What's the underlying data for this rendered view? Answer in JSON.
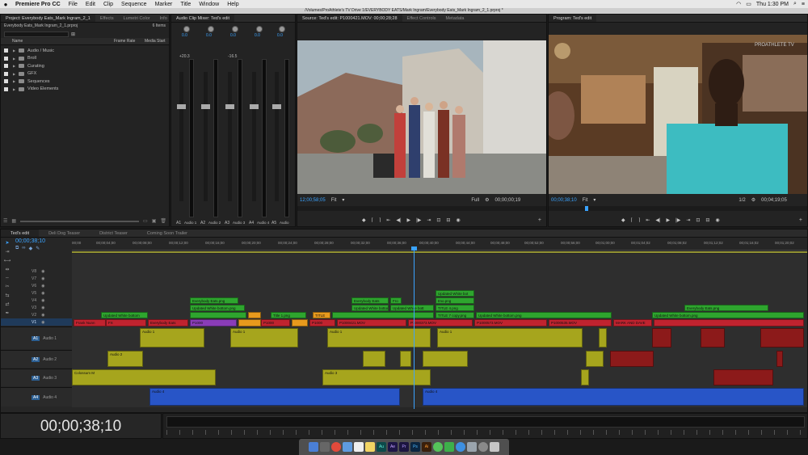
{
  "menubar": {
    "app": "Premiere Pro CC",
    "items": [
      "File",
      "Edit",
      "Clip",
      "Sequence",
      "Marker",
      "Title",
      "Window",
      "Help"
    ],
    "clock": "Thu 1:30 PM"
  },
  "window_title": "/Volumes/ProAthlete's TV Drive 1/EVERYBODY EATS/Mark Ingram/Everybody Eats_Mark Ingram_2_1.prproj *",
  "project": {
    "tabs": [
      "Project: Everybody Eats_Mark Ingram_2_1",
      "Effects",
      "Lumetri Color",
      "Info"
    ],
    "file": "Everybody Eats_Mark Ingram_2_1.prproj",
    "count": "6 Items",
    "search_hint": "",
    "columns": [
      "Name",
      "Frame Rate",
      "Media Start"
    ],
    "items": [
      "Audio / Music",
      "Broll",
      "Curating",
      "GFX",
      "Sequences",
      "Video Elements"
    ]
  },
  "mixer": {
    "tab": "Audio Clip Mixer: Ted's edit",
    "channels": [
      {
        "label": "A1",
        "name": "Audio 1",
        "val": "0.0",
        "db": "+20.3"
      },
      {
        "label": "A2",
        "name": "Audio 2",
        "val": "0.0",
        "db": ""
      },
      {
        "label": "A3",
        "name": "Audio 3",
        "val": "0.0",
        "db": "-16.5"
      },
      {
        "label": "A4",
        "name": "Audio 4",
        "val": "0.0",
        "db": ""
      },
      {
        "label": "A5",
        "name": "Audio",
        "val": "0.0",
        "db": ""
      }
    ]
  },
  "source": {
    "tabs": [
      "Source: Ted's edit: P1000421.MOV: 00;00;28;28",
      "Effect Controls",
      "Metadata"
    ],
    "timecode": "12;00;58;05",
    "fit": "Fit",
    "quality": "Full",
    "duration": "00;00;00;19"
  },
  "program": {
    "tabs": [
      "Program: Ted's edit"
    ],
    "watermark": "PROATHLETE TV",
    "timecode": "00;00;38;10",
    "fit": "Fit",
    "quality": "1/2",
    "duration": "00;04;19;05"
  },
  "timeline": {
    "tabs": [
      "Ted's edit",
      "Deli Dog Teaser",
      "District Teaser",
      "Coming Soon Trailer"
    ],
    "timecode": "00;00;38;10",
    "big_timecode": "00;00;38;10",
    "ruler": [
      "00;00",
      "00;00;04;00",
      "00;00;08;00",
      "00;00;12;00",
      "00;00;16;00",
      "00;00;20;00",
      "00;00;24;00",
      "00;00;28;00",
      "00;00;32;00",
      "00;00;36;00",
      "00;00;40;00",
      "00;00;44;00",
      "00;00;48;00",
      "00;00;52;00",
      "00;00;56;00",
      "00;01;00;00",
      "00;01;04;02",
      "00;01;08;02",
      "00;01;12;02",
      "00;01;16;02",
      "00;01;20;02"
    ],
    "tracks": {
      "video": [
        "V8",
        "V7",
        "V6",
        "V5",
        "V4",
        "V3",
        "V2",
        "V1"
      ],
      "audio": [
        {
          "id": "A1",
          "name": "Audio 1"
        },
        {
          "id": "A2",
          "name": "Audio 2"
        },
        {
          "id": "A3",
          "name": "Audio 3"
        },
        {
          "id": "A4",
          "name": "Audio 4"
        }
      ]
    },
    "clip_labels": {
      "everybody_eats_png": "Everybody Eats.png",
      "updated_white_bottom_png": "Updated White bottom.png",
      "updated_white_bottom_trunc": "Updated White bottom",
      "updated_white_bot": "Updated White bot",
      "updated_white_bottom_pn": "Updated White bottom pn",
      "everybody_eats_pn": "Everybody Eats.pn",
      "fro": "Fro",
      "title_1_png": "Title 1.png",
      "title": "TITLE",
      "title_4_png": "TITLE 4.png",
      "title_7_copy_png": "TITLE 7 copy.png",
      "tmo_png": "tmo.png",
      "updated_white_bott": "Updated White bott",
      "frank_nunn": "Frank Nunn",
      "everybody_eats": "Everybody Eats",
      "p1000": "P1000",
      "p1000421": "P1000421.MOV",
      "p1000373": "P1000373.MOV",
      "p1000573": "P1000573.MOV",
      "p1000535": "P1000535.MOV",
      "fx": "FX",
      "mark_and_dave": "MARK AND DAVE",
      "audio_1": "Audio 1",
      "audio_2": "Audio 2",
      "audio_3": "Audio 3",
      "audio_4": "Audio 4",
      "colossum": "Colossum M"
    }
  },
  "dock_apps": [
    "Finder",
    "Launchpad",
    "Chrome",
    "Mail",
    "Calendar",
    "Notes",
    "Audition",
    "After Effects",
    "Premiere",
    "Photoshop",
    "Illustrator",
    "Messages",
    "Facetime",
    "App Store",
    "Preview",
    "Settings",
    "Trash"
  ]
}
